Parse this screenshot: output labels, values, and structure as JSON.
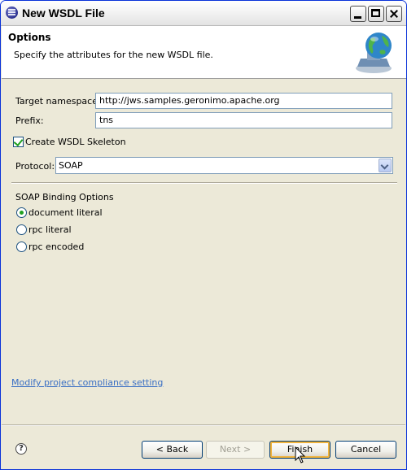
{
  "window": {
    "title": "New WSDL File"
  },
  "header": {
    "title": "Options",
    "description": "Specify the attributes for the new WSDL file."
  },
  "form": {
    "target_namespace_label": "Target namespace:",
    "target_namespace_value": "http://jws.samples.geronimo.apache.org",
    "prefix_label": "Prefix:",
    "prefix_value": "tns",
    "create_skeleton_label": "Create WSDL Skeleton",
    "create_skeleton_checked": true,
    "protocol_label": "Protocol:",
    "protocol_value": "SOAP"
  },
  "binding": {
    "group_label": "SOAP Binding Options",
    "options": [
      {
        "label": "document literal",
        "selected": true
      },
      {
        "label": "rpc literal",
        "selected": false
      },
      {
        "label": "rpc encoded",
        "selected": false
      }
    ]
  },
  "link": {
    "label": "Modify project compliance setting"
  },
  "footer": {
    "help_symbol": "?",
    "back_label": "< Back",
    "next_label": "Next >",
    "finish_label": "Finish",
    "cancel_label": "Cancel"
  },
  "colors": {
    "link": "#3a6fc4",
    "check": "#21a121",
    "dialog_bg": "#ece9d8"
  },
  "icons": {
    "app": "eclipse-icon",
    "wizard": "wsdl-globe-icon",
    "help": "help-icon"
  }
}
